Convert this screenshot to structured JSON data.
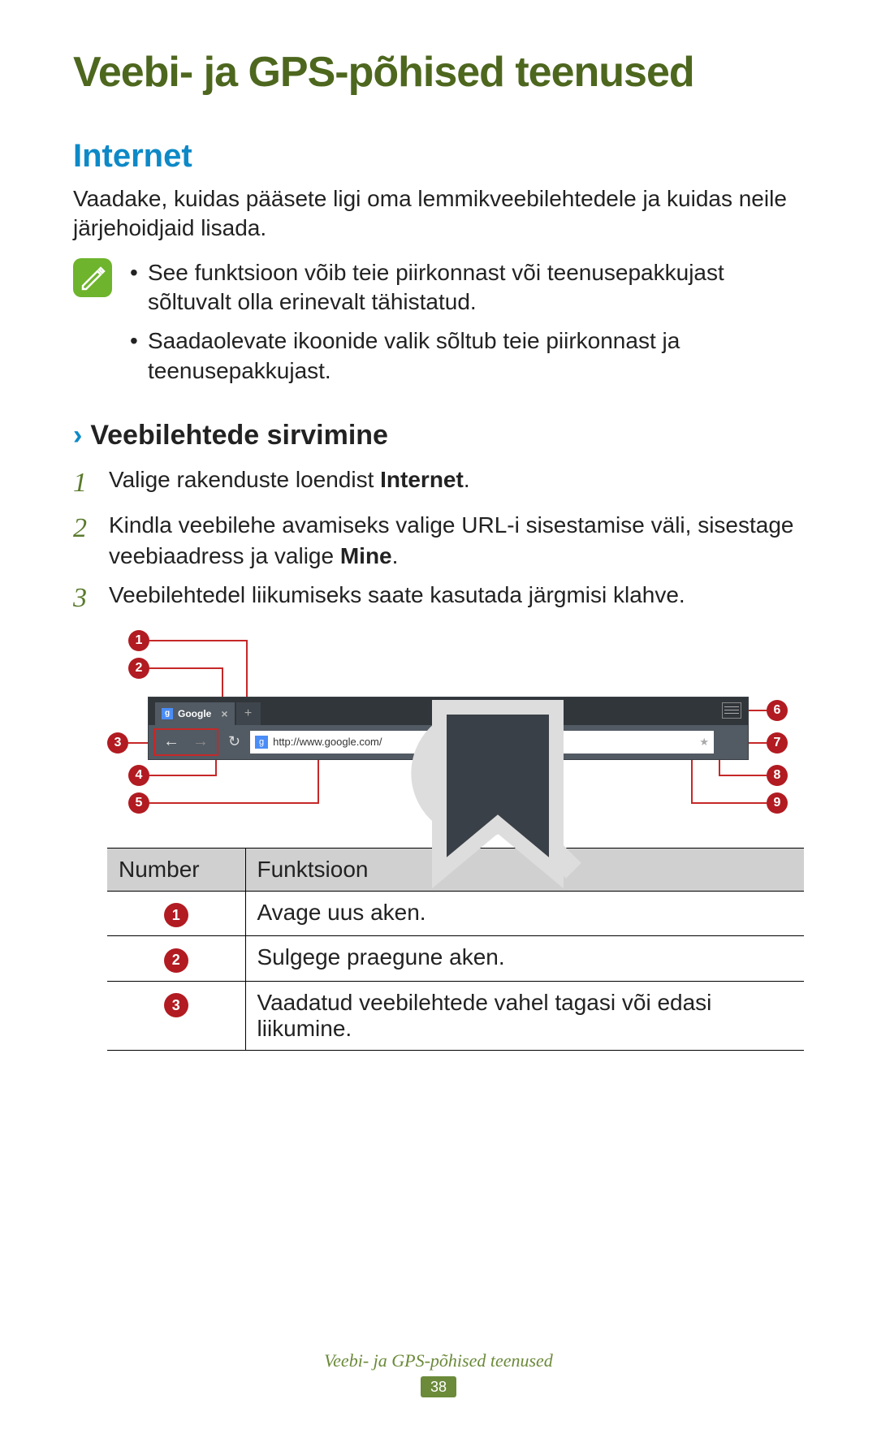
{
  "title": "Veebi- ja GPS-põhised teenused",
  "section_heading": "Internet",
  "intro": "Vaadake, kuidas pääsete ligi oma lemmikveebilehtedele ja kuidas neile järjehoidjaid lisada.",
  "notes": [
    "See funktsioon võib teie piirkonnast või teenusepakkujast sõltuvalt olla erinevalt tähistatud.",
    "Saadaolevate ikoonide valik sõltub teie piirkonnast ja teenusepakkujast."
  ],
  "sub_heading": "Veebilehtede sirvimine",
  "steps": [
    {
      "num": "1",
      "segments": [
        {
          "text": "Valige rakenduste loendist ",
          "bold": false
        },
        {
          "text": "Internet",
          "bold": true
        },
        {
          "text": ".",
          "bold": false
        }
      ]
    },
    {
      "num": "2",
      "segments": [
        {
          "text": "Kindla veebilehe avamiseks valige URL-i sisestamise väli, sisestage veebiaadress ja valige ",
          "bold": false
        },
        {
          "text": "Mine",
          "bold": true
        },
        {
          "text": ".",
          "bold": false
        }
      ]
    },
    {
      "num": "3",
      "segments": [
        {
          "text": "Veebilehtedel liikumiseks saate kasutada järgmisi klahve.",
          "bold": false
        }
      ]
    }
  ],
  "mock": {
    "tab_label": "Google",
    "url": "http://www.google.com/"
  },
  "callouts": [
    "1",
    "2",
    "3",
    "4",
    "5",
    "6",
    "7",
    "8",
    "9"
  ],
  "table": {
    "headers": [
      "Number",
      "Funktsioon"
    ],
    "rows": [
      {
        "num": "1",
        "desc": "Avage uus aken."
      },
      {
        "num": "2",
        "desc": "Sulgege praegune aken."
      },
      {
        "num": "3",
        "desc": "Vaadatud veebilehtede vahel tagasi või edasi liikumine."
      }
    ]
  },
  "footer_text": "Veebi- ja GPS-põhised teenused",
  "page_number": "38"
}
